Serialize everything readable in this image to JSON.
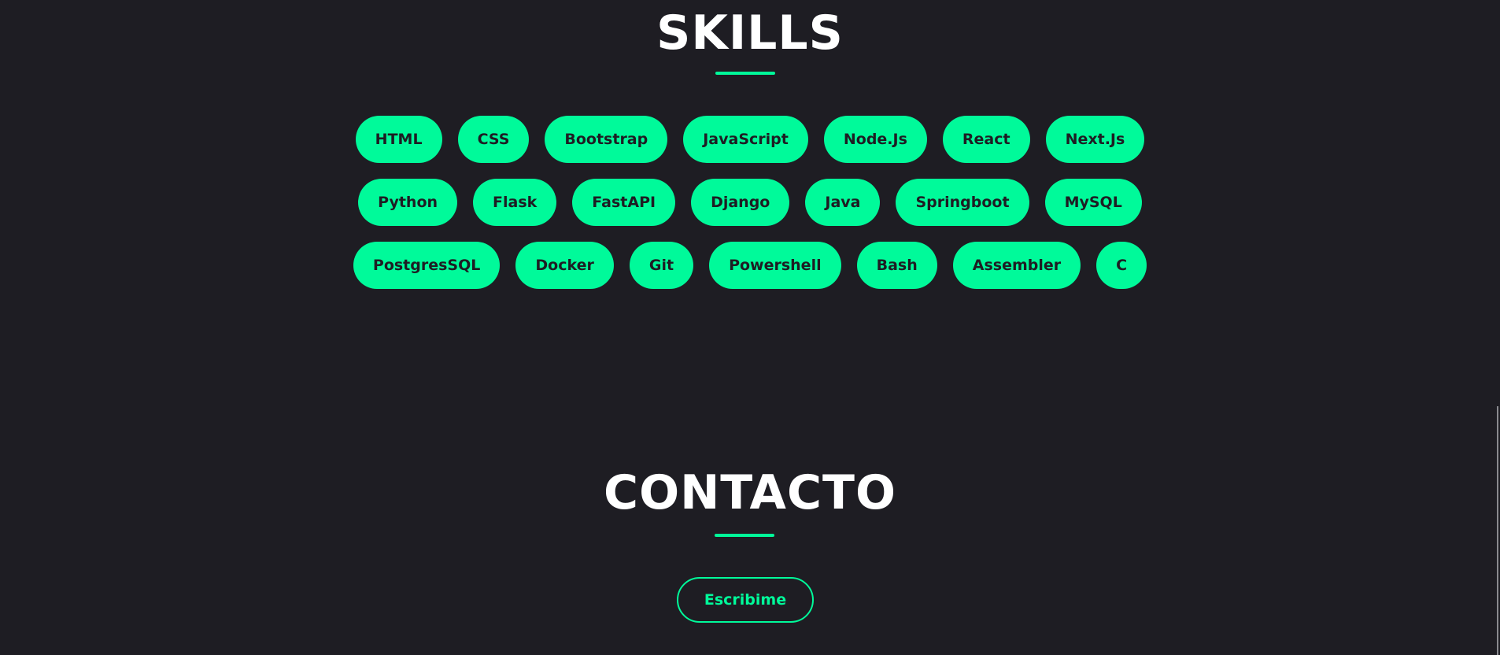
{
  "colors": {
    "accent": "#00fa9a",
    "background": "#1e1d23",
    "heading": "#ffffff",
    "pill_text": "#1e1d23"
  },
  "skills": {
    "title": "SKILLS",
    "rows": [
      [
        "HTML",
        "CSS",
        "Bootstrap",
        "JavaScript",
        "Node.Js",
        "React",
        "Next.Js"
      ],
      [
        "Python",
        "Flask",
        "FastAPI",
        "Django",
        "Java",
        "Springboot",
        "MySQL"
      ],
      [
        "PostgresSQL",
        "Docker",
        "Git",
        "Powershell",
        "Bash",
        "Assembler",
        "C"
      ]
    ]
  },
  "contact": {
    "title": "CONTACTO",
    "button_label": "Escribime"
  }
}
